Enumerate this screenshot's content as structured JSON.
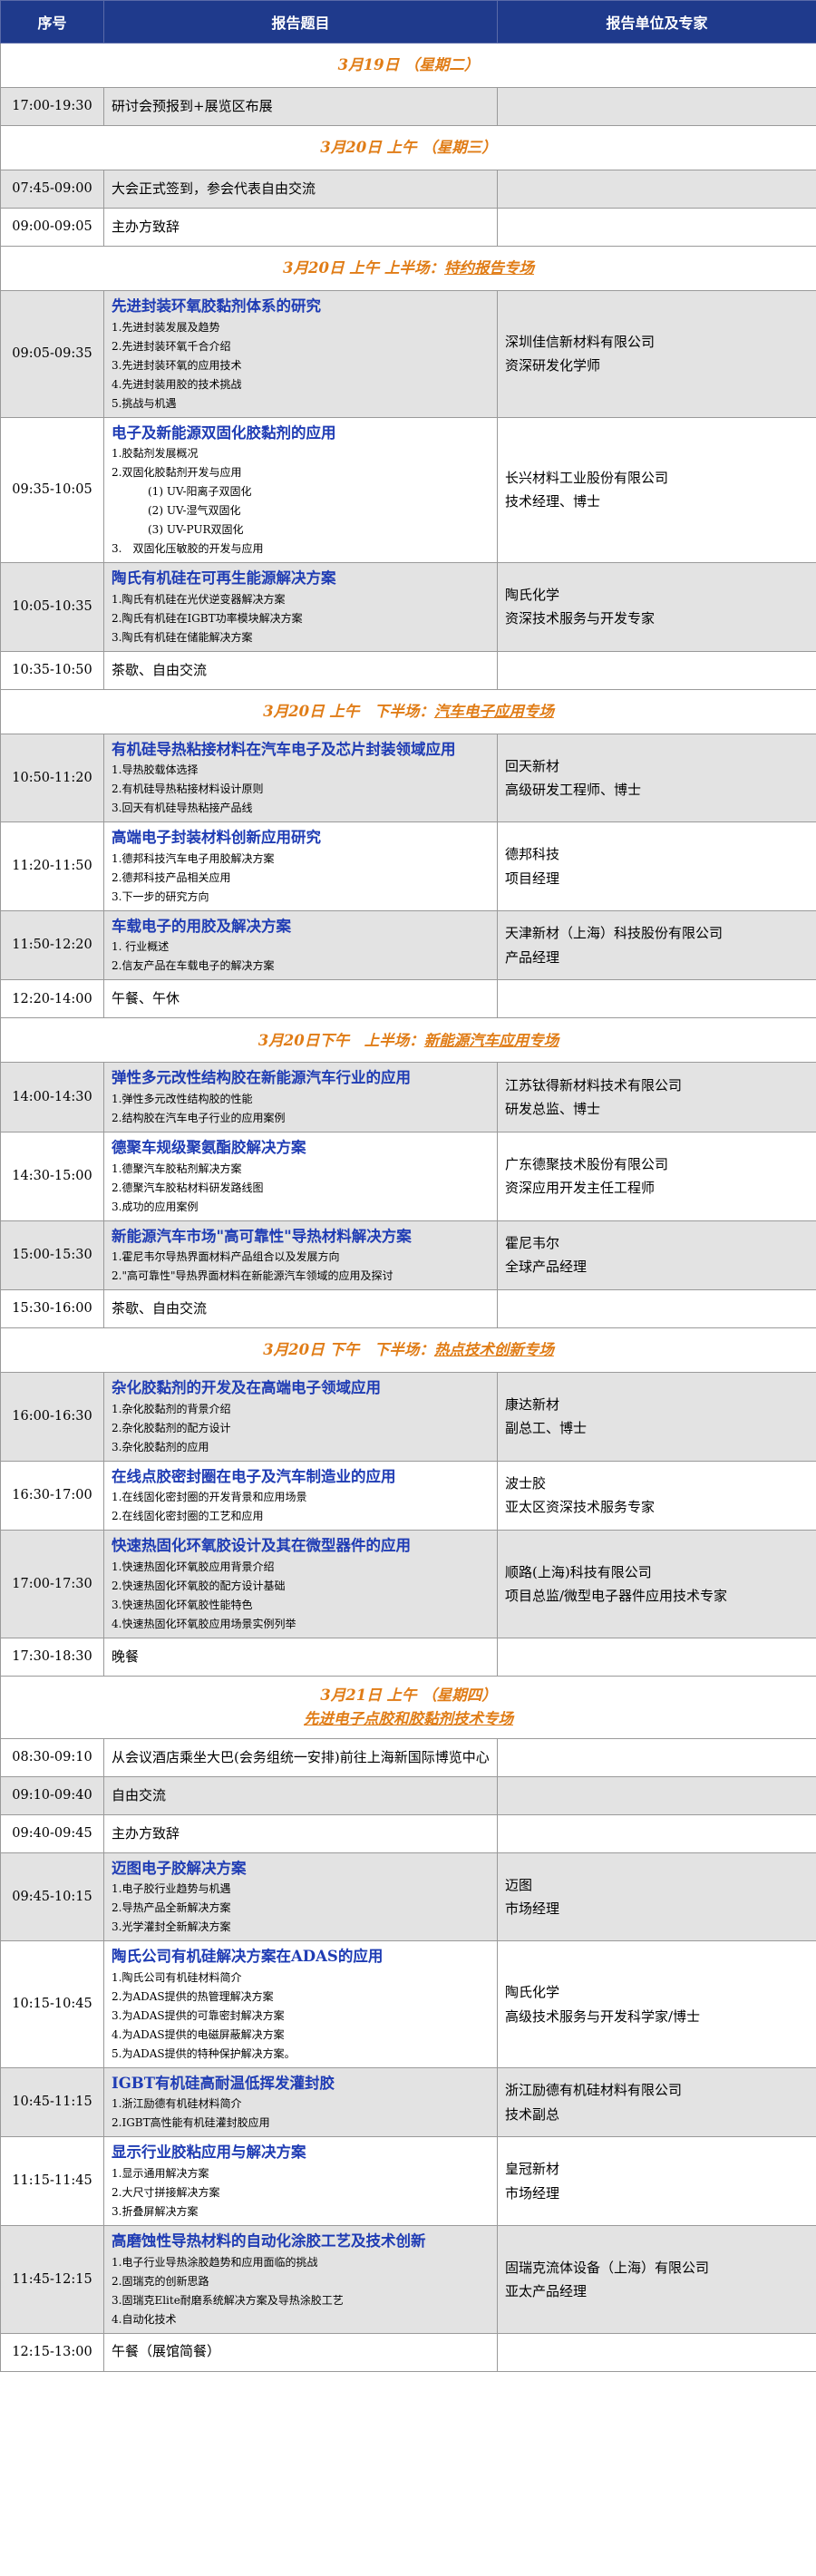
{
  "header": {
    "col1": "序号",
    "col2": "报告题目",
    "col3": "报告单位及专家"
  },
  "rows": [
    {
      "type": "section",
      "date": "3月19日 （星期二）",
      "session": ""
    },
    {
      "type": "plain",
      "time": "17:00-19:30",
      "text": "研讨会预报到+展览区布展",
      "tone": "gray"
    },
    {
      "type": "section",
      "date": "3月20日 上午 （星期三）",
      "session": ""
    },
    {
      "type": "plain",
      "time": "07:45-09:00",
      "text": "大会正式签到，参会代表自由交流",
      "tone": "gray"
    },
    {
      "type": "plain",
      "time": "09:00-09:05",
      "text": "主办方致辞",
      "tone": "white"
    },
    {
      "type": "section",
      "date": "3月20日 上午 上半场：",
      "session": "特约报告专场"
    },
    {
      "type": "talk",
      "time": "09:05-09:35",
      "tone": "gray",
      "title": "先进封装环氧胶黏剂体系的研究",
      "items": [
        "1.先进封装发展及趋势",
        "2.先进封装环氧千合介绍",
        "3.先进封装环氧的应用技术",
        "4.先进封装用胶的技术挑战",
        "5.挑战与机遇"
      ],
      "org": [
        "深圳佳信新材料有限公司",
        "资深研发化学师"
      ]
    },
    {
      "type": "talk",
      "time": "09:35-10:05",
      "tone": "white",
      "title": "电子及新能源双固化胶黏剂的应用",
      "items": [
        "1.胶黏剂发展概况",
        "2.双固化胶黏剂开发与应用",
        "(1) UV-阳离子双固化",
        "(2) UV-湿气双固化",
        "(3) UV-PUR双固化",
        "3.　双固化压敏胶的开发与应用"
      ],
      "indent": [
        2,
        3,
        4
      ],
      "org": [
        "长兴材料工业股份有限公司",
        "技术经理、博士"
      ]
    },
    {
      "type": "talk",
      "time": "10:05-10:35",
      "tone": "gray",
      "title": "陶氏有机硅在可再生能源解决方案",
      "items": [
        "1.陶氏有机硅在光伏逆变器解决方案",
        "2.陶氏有机硅在IGBT功率模块解决方案",
        "3.陶氏有机硅在储能解决方案"
      ],
      "org": [
        "陶氏化学",
        "资深技术服务与开发专家"
      ]
    },
    {
      "type": "plain",
      "time": "10:35-10:50",
      "text": "茶歇、自由交流",
      "tone": "white"
    },
    {
      "type": "section",
      "date": "3月20日 上午　下半场：",
      "session": "汽车电子应用专场"
    },
    {
      "type": "talk",
      "time": "10:50-11:20",
      "tone": "gray",
      "title": "有机硅导热粘接材料在汽车电子及芯片封装领域应用",
      "items": [
        "1.导热胶载体选择",
        "2.有机硅导热粘接材料设计原则",
        "3.回天有机硅导热粘接产品线"
      ],
      "org": [
        "回天新材",
        "高级研发工程师、博士"
      ]
    },
    {
      "type": "talk",
      "time": "11:20-11:50",
      "tone": "white",
      "title": "高端电子封装材料创新应用研究",
      "items": [
        "1.德邦科技汽车电子用胶解决方案",
        "2.德邦科技产品相关应用",
        "3.下一步的研究方向"
      ],
      "org": [
        "德邦科技",
        "项目经理"
      ]
    },
    {
      "type": "talk",
      "time": "11:50-12:20",
      "tone": "gray",
      "title": "车载电子的用胶及解决方案",
      "items": [
        "1. 行业概述",
        "2.信友产品在车载电子的解决方案"
      ],
      "org": [
        "天津新材（上海）科技股份有限公司",
        "产品经理"
      ]
    },
    {
      "type": "plain",
      "time": "12:20-14:00",
      "text": "午餐、午休",
      "tone": "white"
    },
    {
      "type": "section",
      "date": "3月20日下午　上半场：",
      "session": "新能源汽车应用专场"
    },
    {
      "type": "talk",
      "time": "14:00-14:30",
      "tone": "gray",
      "title": "弹性多元改性结构胶在新能源汽车行业的应用",
      "items": [
        "1.弹性多元改性结构胶的性能",
        "2.结构胶在汽车电子行业的应用案例"
      ],
      "org": [
        "江苏钛得新材料技术有限公司",
        "研发总监、博士"
      ]
    },
    {
      "type": "talk",
      "time": "14:30-15:00",
      "tone": "white",
      "title": "德聚车规级聚氨酯胶解决方案",
      "items": [
        "1.德聚汽车胶粘剂解决方案",
        "2.德聚汽车胶粘材料研发路线图",
        "3.成功的应用案例"
      ],
      "org": [
        "广东德聚技术股份有限公司",
        "资深应用开发主任工程师"
      ]
    },
    {
      "type": "talk",
      "time": "15:00-15:30",
      "tone": "gray",
      "title": "新能源汽车市场\"高可靠性\"导热材料解决方案",
      "items": [
        "1.霍尼韦尔导热界面材料产品组合以及发展方向",
        "2.\"高可靠性\"导热界面材料在新能源汽车领域的应用及探讨"
      ],
      "org": [
        "霍尼韦尔",
        "全球产品经理"
      ]
    },
    {
      "type": "plain",
      "time": "15:30-16:00",
      "text": "茶歇、自由交流",
      "tone": "white"
    },
    {
      "type": "section",
      "date": "3月20日 下午　下半场：",
      "session": "热点技术创新专场"
    },
    {
      "type": "talk",
      "time": "16:00-16:30",
      "tone": "gray",
      "title": "杂化胶黏剂的开发及在高端电子领域应用",
      "items": [
        "1.杂化胶黏剂的背景介绍",
        "2.杂化胶黏剂的配方设计",
        "3.杂化胶黏剂的应用"
      ],
      "org": [
        "康达新材",
        "副总工、博士"
      ]
    },
    {
      "type": "talk",
      "time": "16:30-17:00",
      "tone": "white",
      "title": "在线点胶密封圈在电子及汽车制造业的应用",
      "items": [
        "1.在线固化密封圈的开发背景和应用场景",
        "2.在线固化密封圈的工艺和应用"
      ],
      "org": [
        "波士胶",
        "亚太区资深技术服务专家"
      ]
    },
    {
      "type": "talk",
      "time": "17:00-17:30",
      "tone": "gray",
      "title": "快速热固化环氧胶设计及其在微型器件的应用",
      "items": [
        "1.快速热固化环氧胶应用背景介绍",
        "2.快速热固化环氧胶的配方设计基础",
        "3.快速热固化环氧胶性能特色",
        "4.快速热固化环氧胶应用场景实例列举"
      ],
      "org": [
        "顺路(上海)科技有限公司",
        "项目总监/微型电子器件应用技术专家"
      ]
    },
    {
      "type": "plain",
      "time": "17:30-18:30",
      "text": "晚餐",
      "tone": "white"
    },
    {
      "type": "section2",
      "date": "3月21日 上午 （星期四）",
      "session": "先进电子点胶和胶黏剂技术专场"
    },
    {
      "type": "plain",
      "time": "08:30-09:10",
      "text": "从会议酒店乘坐大巴(会务组统一安排)前往上海新国际博览中心",
      "tone": "white"
    },
    {
      "type": "plain",
      "time": "09:10-09:40",
      "text": "自由交流",
      "tone": "gray"
    },
    {
      "type": "plain",
      "time": "09:40-09:45",
      "text": "主办方致辞",
      "tone": "white"
    },
    {
      "type": "talk",
      "time": "09:45-10:15",
      "tone": "gray",
      "title": "迈图电子胶解决方案",
      "items": [
        "1.电子胶行业趋势与机遇",
        "2.导热产品全新解决方案",
        "3.光学灌封全新解决方案"
      ],
      "org": [
        "迈图",
        "市场经理"
      ]
    },
    {
      "type": "talk",
      "time": "10:15-10:45",
      "tone": "white",
      "title": "陶氏公司有机硅解决方案在ADAS的应用",
      "items": [
        "1.陶氏公司有机硅材料简介",
        "2.为ADAS提供的热管理解决方案",
        "3.为ADAS提供的可靠密封解决方案",
        "4.为ADAS提供的电磁屏蔽解决方案",
        "5.为ADAS提供的特种保护解决方案。"
      ],
      "org": [
        "陶氏化学",
        "高级技术服务与开发科学家/博士"
      ]
    },
    {
      "type": "talk",
      "time": "10:45-11:15",
      "tone": "gray",
      "title": "IGBT有机硅高耐温低挥发灌封胶",
      "items": [
        "1.浙江励德有机硅材料简介",
        "2.IGBT高性能有机硅灌封胶应用"
      ],
      "org": [
        "浙江励德有机硅材料有限公司",
        "技术副总"
      ]
    },
    {
      "type": "talk",
      "time": "11:15-11:45",
      "tone": "white",
      "title": "显示行业胶粘应用与解决方案",
      "items": [
        "1.显示通用解决方案",
        "2.大尺寸拼接解决方案",
        "3.折叠屏解决方案"
      ],
      "org": [
        "皇冠新材",
        "市场经理"
      ]
    },
    {
      "type": "talk",
      "time": "11:45-12:15",
      "tone": "gray",
      "title": "高磨蚀性导热材料的自动化涂胶工艺及技术创新",
      "items": [
        "1.电子行业导热涂胶趋势和应用面临的挑战",
        "2.固瑞克的创新思路",
        "3.固瑞克Elite耐磨系统解决方案及导热涂胶工艺",
        "4.自动化技术"
      ],
      "org": [
        "固瑞克流体设备（上海）有限公司",
        "亚太产品经理"
      ]
    },
    {
      "type": "plain",
      "time": "12:15-13:00",
      "text": "午餐（展馆简餐）",
      "tone": "white"
    }
  ]
}
